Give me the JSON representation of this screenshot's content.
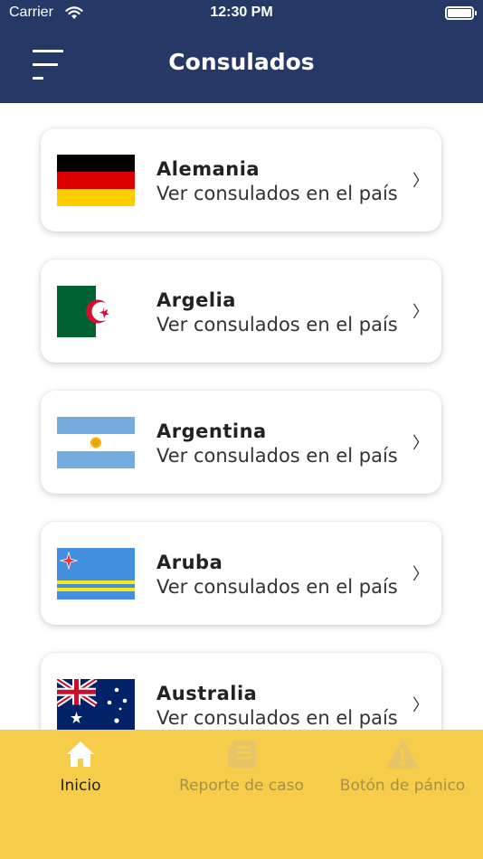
{
  "status_bar": {
    "carrier": "Carrier",
    "time": "12:30 PM"
  },
  "header": {
    "title": "Consulados"
  },
  "countries": [
    {
      "name": "Alemania",
      "subtitle": "Ver consulados en el país",
      "flag": "germany-flag"
    },
    {
      "name": "Argelia",
      "subtitle": "Ver consulados en el país",
      "flag": "algeria-flag"
    },
    {
      "name": "Argentina",
      "subtitle": "Ver consulados en el país",
      "flag": "argentina-flag"
    },
    {
      "name": "Aruba",
      "subtitle": "Ver consulados en el país",
      "flag": "aruba-flag"
    },
    {
      "name": "Australia",
      "subtitle": "Ver consulados en el país",
      "flag": "australia-flag"
    }
  ],
  "tabs": [
    {
      "label": "Inicio",
      "icon": "home-icon",
      "active": true
    },
    {
      "label": "Reporte de caso",
      "icon": "document-icon",
      "active": false
    },
    {
      "label": "Botón de pánico",
      "icon": "warning-icon",
      "active": false
    }
  ],
  "colors": {
    "header_bg": "#253866",
    "tab_bar_bg": "#f6cd4b",
    "tab_active": "#ffffff",
    "tab_inactive": "#e6c468"
  }
}
